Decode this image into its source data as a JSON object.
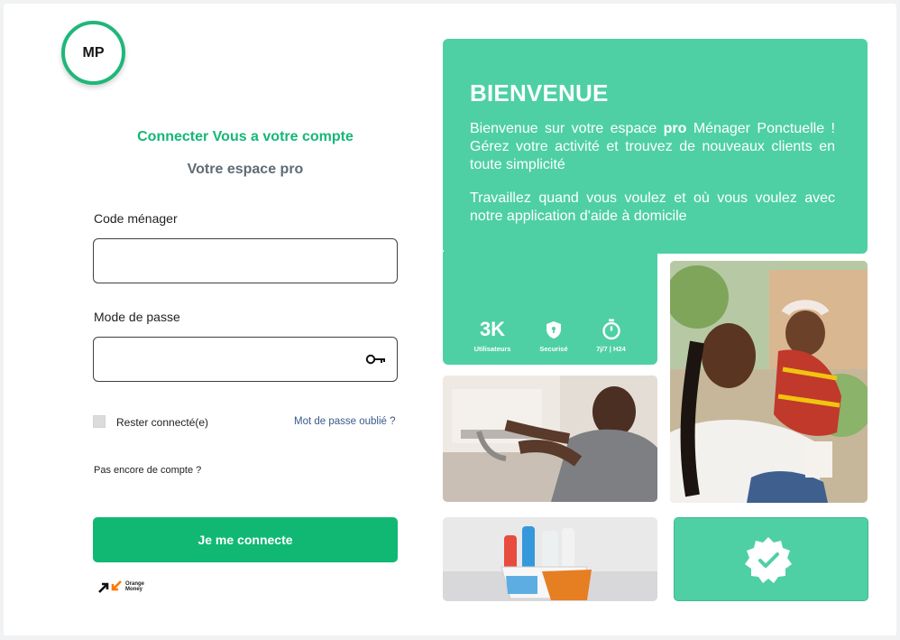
{
  "brand": {
    "logo_text": "MP"
  },
  "login": {
    "title": "Connecter Vous a votre compte",
    "subtitle": "Votre espace pro",
    "code_label": "Code ménager",
    "code_value": "",
    "password_label": "Mode de passe",
    "password_value": "",
    "remember_label": "Rester connecté(e)",
    "forgot_label": "Mot de passe oublié ?",
    "no_account": "Pas encore de compte ?",
    "submit_label": "Je me connecte",
    "partner_name_line1": "Orange",
    "partner_name_line2": "Money"
  },
  "welcome": {
    "title": "BIENVENUE",
    "para1_before": "Bienvenue sur votre espace ",
    "para1_bold": "pro",
    "para1_after": " Ménager Ponctuelle ! Gérez votre activité et trouvez de nouveaux clients en toute simplicité",
    "para2": "Travaillez quand vous voulez et où vous voulez avec notre application d'aide à domicile"
  },
  "stats": [
    {
      "value": "3K",
      "label": "Utilisateurs",
      "icon": "users-count"
    },
    {
      "value": "",
      "label": "Securisé",
      "icon": "shield-icon"
    },
    {
      "value": "",
      "label": "7j/7 | H24",
      "icon": "stopwatch-icon"
    }
  ],
  "colors": {
    "brand_green": "#11b874",
    "panel_green": "#4ed0a4",
    "link_blue": "#3b5a8c"
  }
}
